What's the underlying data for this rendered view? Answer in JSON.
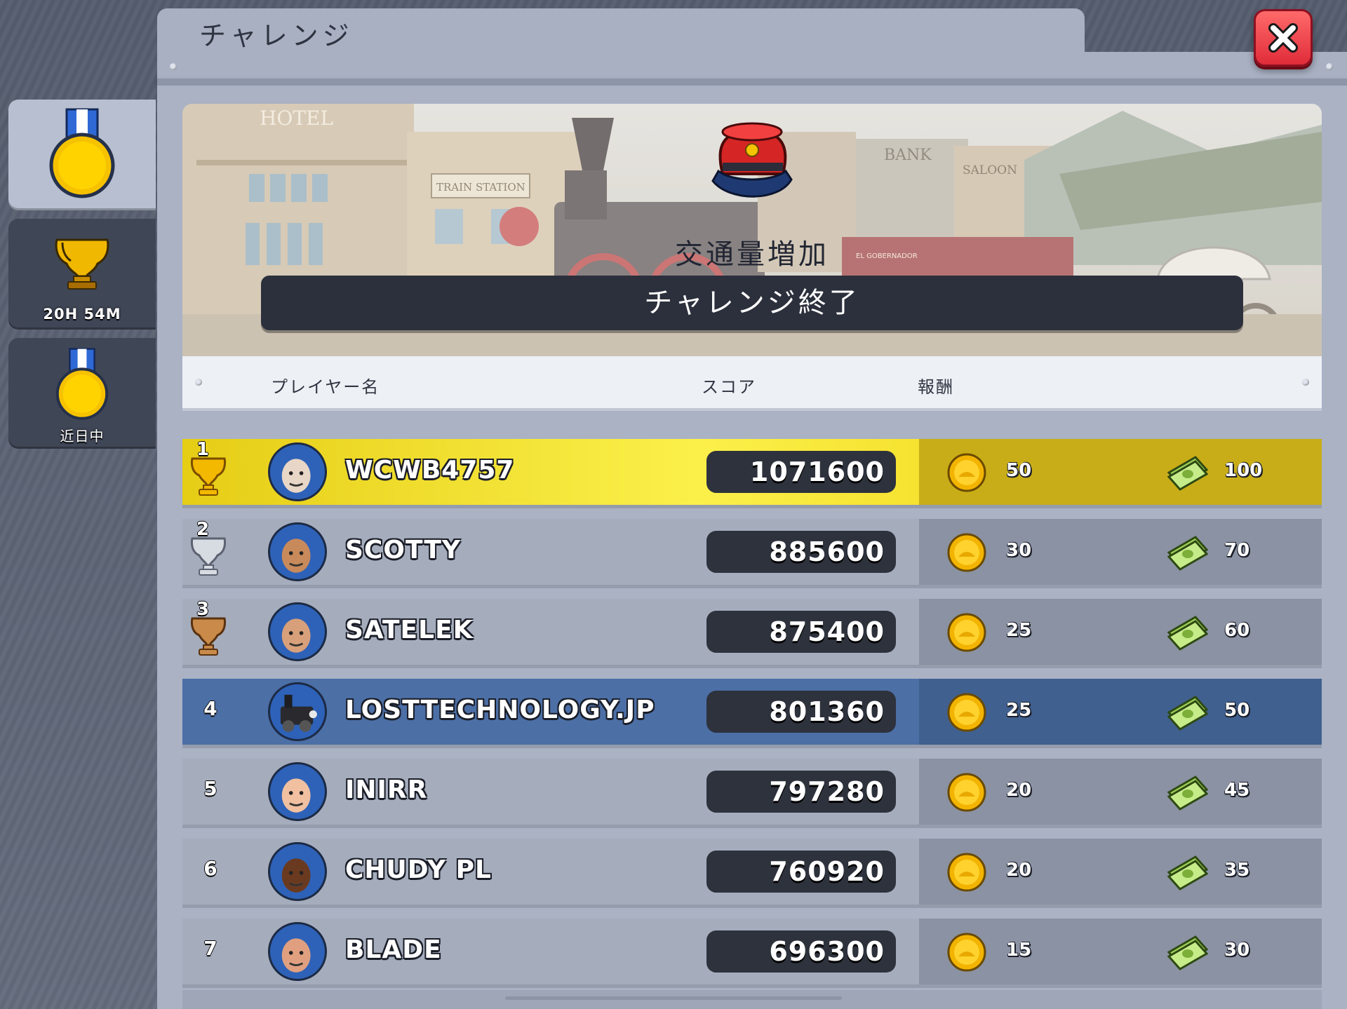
{
  "window": {
    "title": "チャレンジ"
  },
  "sidebar": {
    "tabs": [
      {
        "id": "current",
        "icon": "medal-icon",
        "label": ""
      },
      {
        "id": "league",
        "icon": "trophy-icon",
        "label": "20H 54M"
      },
      {
        "id": "upcoming",
        "icon": "medal-icon",
        "label": "近日中"
      }
    ]
  },
  "banner": {
    "challenge_name": "交通量増加",
    "status": "チャレンジ終了",
    "sign_labels": [
      "HOTEL",
      "TRAIN STATION",
      "BANK",
      "SALOON",
      "EL GOBERNADOR"
    ]
  },
  "columns": {
    "player": "プレイヤー名",
    "score": "スコア",
    "reward": "報酬"
  },
  "colors": {
    "gold_row": "#f3e02c",
    "player_row": "#4c6fa6",
    "close_button": "#e33040"
  },
  "leaderboard": [
    {
      "rank": "1",
      "name": "WCWB4757",
      "score": "1071600",
      "coins": "50",
      "cash": "100",
      "trophy": "gold-trophy-icon",
      "avatar": "old-man-beard-avatar",
      "highlight": "first"
    },
    {
      "rank": "2",
      "name": "SCOTTY",
      "score": "885600",
      "coins": "30",
      "cash": "70",
      "trophy": "silver-trophy-icon",
      "avatar": "cowboy-hat-avatar"
    },
    {
      "rank": "3",
      "name": "SATELEK",
      "score": "875400",
      "coins": "25",
      "cash": "60",
      "trophy": "bronze-trophy-icon",
      "avatar": "bald-man-avatar"
    },
    {
      "rank": "4",
      "name": "LOSTTECHNOLOGY.JP",
      "score": "801360",
      "coins": "25",
      "cash": "50",
      "avatar": "locomotive-avatar",
      "highlight": "me"
    },
    {
      "rank": "5",
      "name": "INIRR",
      "score": "797280",
      "coins": "20",
      "cash": "45",
      "avatar": "white-cowboy-hat-avatar"
    },
    {
      "rank": "6",
      "name": "CHUDY PL",
      "score": "760920",
      "coins": "20",
      "cash": "35",
      "avatar": "glasses-man-avatar"
    },
    {
      "rank": "7",
      "name": "BLADE",
      "score": "696300",
      "coins": "15",
      "cash": "30",
      "avatar": "hard-hat-avatar"
    }
  ]
}
